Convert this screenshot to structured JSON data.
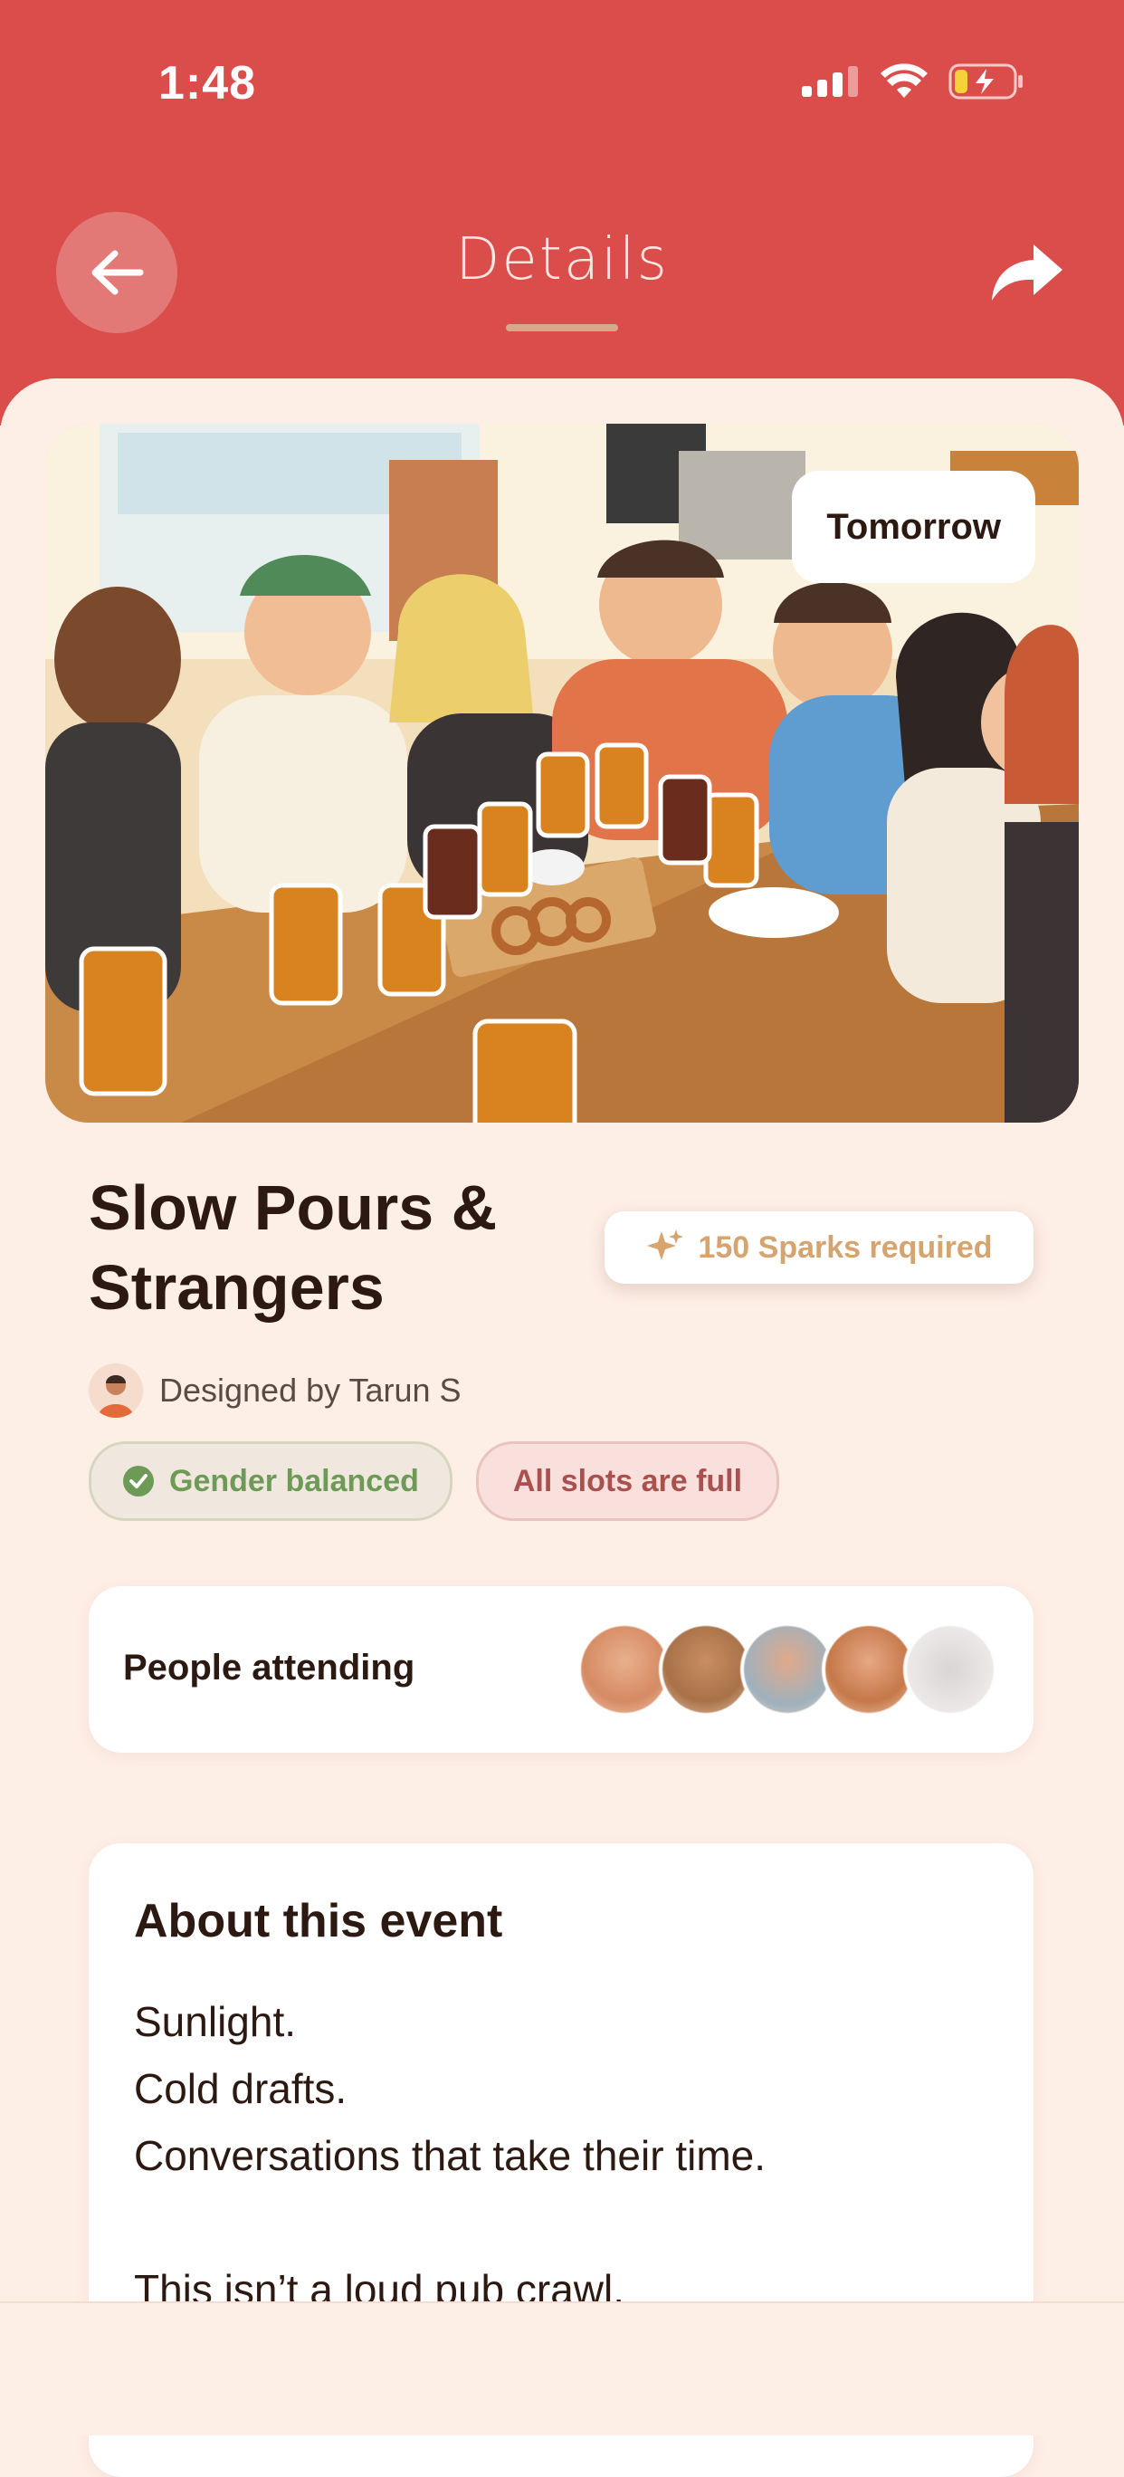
{
  "status_bar": {
    "time": "1:48"
  },
  "nav": {
    "title": "Details"
  },
  "hero": {
    "date_chip": "Tomorrow"
  },
  "event": {
    "title": "Slow Pours & Strangers",
    "sparks_label": "150 Sparks required",
    "designed_by": "Designed by Tarun S",
    "tags": [
      "Gender balanced",
      "All slots are full"
    ]
  },
  "attending": {
    "label": "People attending",
    "avatar_count": 5
  },
  "about": {
    "title": "About this event",
    "body": "Sunlight.\nCold drafts.\nConversations that take their time.\n\nThis isn’t a loud pub crawl."
  },
  "colors": {
    "header": "#da4d4a",
    "background": "#fdeee6",
    "accent_gold": "#d5a46f",
    "green": "#6e9a57"
  }
}
